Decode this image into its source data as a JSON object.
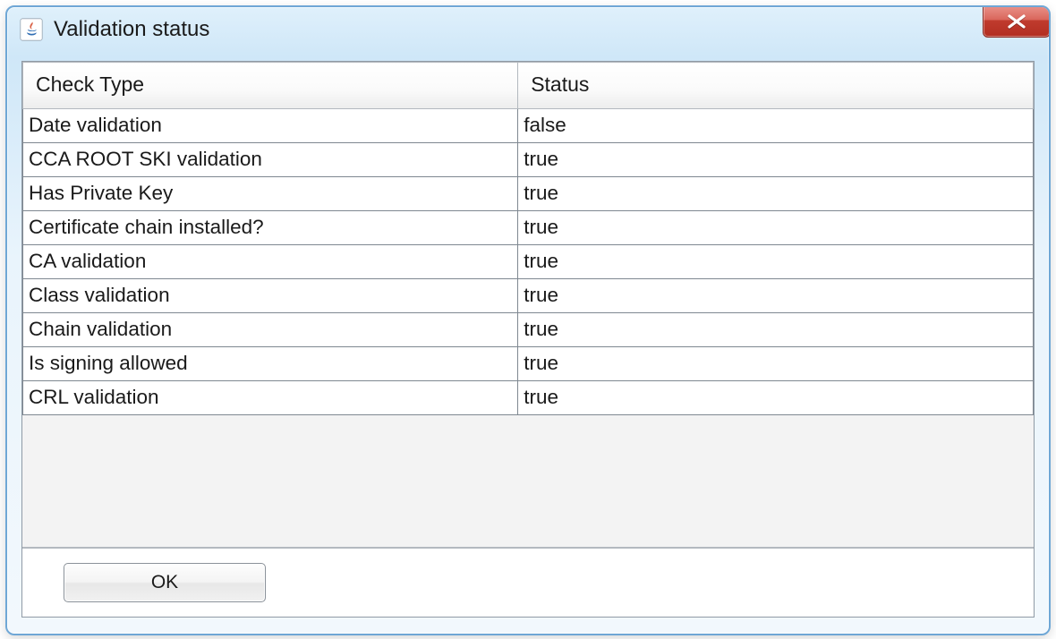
{
  "window": {
    "title": "Validation status"
  },
  "table": {
    "columns": {
      "check_type": "Check Type",
      "status": "Status"
    },
    "rows": [
      {
        "check_type": "Date validation",
        "status": "false"
      },
      {
        "check_type": "CCA ROOT SKI validation",
        "status": "true"
      },
      {
        "check_type": "Has Private Key",
        "status": "true"
      },
      {
        "check_type": "Certificate chain installed?",
        "status": "true"
      },
      {
        "check_type": "CA validation",
        "status": "true"
      },
      {
        "check_type": "Class validation",
        "status": "true"
      },
      {
        "check_type": "Chain validation",
        "status": "true"
      },
      {
        "check_type": "Is signing allowed",
        "status": "true"
      },
      {
        "check_type": "CRL validation",
        "status": "true"
      }
    ]
  },
  "buttons": {
    "ok": "OK"
  }
}
